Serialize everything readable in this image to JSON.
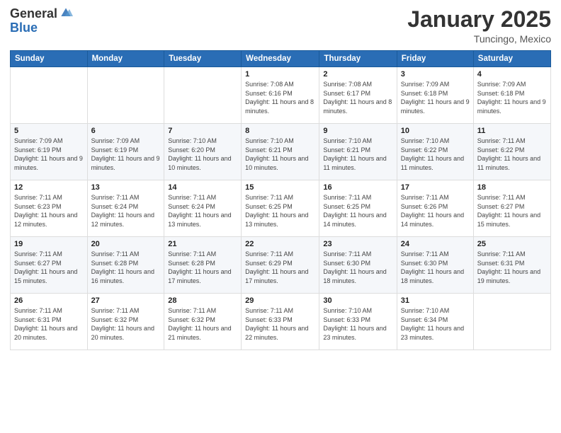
{
  "logo": {
    "general": "General",
    "blue": "Blue"
  },
  "header": {
    "month": "January 2025",
    "location": "Tuncingo, Mexico"
  },
  "days_of_week": [
    "Sunday",
    "Monday",
    "Tuesday",
    "Wednesday",
    "Thursday",
    "Friday",
    "Saturday"
  ],
  "weeks": [
    [
      {
        "num": "",
        "detail": ""
      },
      {
        "num": "",
        "detail": ""
      },
      {
        "num": "",
        "detail": ""
      },
      {
        "num": "1",
        "detail": "Sunrise: 7:08 AM\nSunset: 6:16 PM\nDaylight: 11 hours and 8 minutes."
      },
      {
        "num": "2",
        "detail": "Sunrise: 7:08 AM\nSunset: 6:17 PM\nDaylight: 11 hours and 8 minutes."
      },
      {
        "num": "3",
        "detail": "Sunrise: 7:09 AM\nSunset: 6:18 PM\nDaylight: 11 hours and 9 minutes."
      },
      {
        "num": "4",
        "detail": "Sunrise: 7:09 AM\nSunset: 6:18 PM\nDaylight: 11 hours and 9 minutes."
      }
    ],
    [
      {
        "num": "5",
        "detail": "Sunrise: 7:09 AM\nSunset: 6:19 PM\nDaylight: 11 hours and 9 minutes."
      },
      {
        "num": "6",
        "detail": "Sunrise: 7:09 AM\nSunset: 6:19 PM\nDaylight: 11 hours and 9 minutes."
      },
      {
        "num": "7",
        "detail": "Sunrise: 7:10 AM\nSunset: 6:20 PM\nDaylight: 11 hours and 10 minutes."
      },
      {
        "num": "8",
        "detail": "Sunrise: 7:10 AM\nSunset: 6:21 PM\nDaylight: 11 hours and 10 minutes."
      },
      {
        "num": "9",
        "detail": "Sunrise: 7:10 AM\nSunset: 6:21 PM\nDaylight: 11 hours and 11 minutes."
      },
      {
        "num": "10",
        "detail": "Sunrise: 7:10 AM\nSunset: 6:22 PM\nDaylight: 11 hours and 11 minutes."
      },
      {
        "num": "11",
        "detail": "Sunrise: 7:11 AM\nSunset: 6:22 PM\nDaylight: 11 hours and 11 minutes."
      }
    ],
    [
      {
        "num": "12",
        "detail": "Sunrise: 7:11 AM\nSunset: 6:23 PM\nDaylight: 11 hours and 12 minutes."
      },
      {
        "num": "13",
        "detail": "Sunrise: 7:11 AM\nSunset: 6:24 PM\nDaylight: 11 hours and 12 minutes."
      },
      {
        "num": "14",
        "detail": "Sunrise: 7:11 AM\nSunset: 6:24 PM\nDaylight: 11 hours and 13 minutes."
      },
      {
        "num": "15",
        "detail": "Sunrise: 7:11 AM\nSunset: 6:25 PM\nDaylight: 11 hours and 13 minutes."
      },
      {
        "num": "16",
        "detail": "Sunrise: 7:11 AM\nSunset: 6:25 PM\nDaylight: 11 hours and 14 minutes."
      },
      {
        "num": "17",
        "detail": "Sunrise: 7:11 AM\nSunset: 6:26 PM\nDaylight: 11 hours and 14 minutes."
      },
      {
        "num": "18",
        "detail": "Sunrise: 7:11 AM\nSunset: 6:27 PM\nDaylight: 11 hours and 15 minutes."
      }
    ],
    [
      {
        "num": "19",
        "detail": "Sunrise: 7:11 AM\nSunset: 6:27 PM\nDaylight: 11 hours and 15 minutes."
      },
      {
        "num": "20",
        "detail": "Sunrise: 7:11 AM\nSunset: 6:28 PM\nDaylight: 11 hours and 16 minutes."
      },
      {
        "num": "21",
        "detail": "Sunrise: 7:11 AM\nSunset: 6:28 PM\nDaylight: 11 hours and 17 minutes."
      },
      {
        "num": "22",
        "detail": "Sunrise: 7:11 AM\nSunset: 6:29 PM\nDaylight: 11 hours and 17 minutes."
      },
      {
        "num": "23",
        "detail": "Sunrise: 7:11 AM\nSunset: 6:30 PM\nDaylight: 11 hours and 18 minutes."
      },
      {
        "num": "24",
        "detail": "Sunrise: 7:11 AM\nSunset: 6:30 PM\nDaylight: 11 hours and 18 minutes."
      },
      {
        "num": "25",
        "detail": "Sunrise: 7:11 AM\nSunset: 6:31 PM\nDaylight: 11 hours and 19 minutes."
      }
    ],
    [
      {
        "num": "26",
        "detail": "Sunrise: 7:11 AM\nSunset: 6:31 PM\nDaylight: 11 hours and 20 minutes."
      },
      {
        "num": "27",
        "detail": "Sunrise: 7:11 AM\nSunset: 6:32 PM\nDaylight: 11 hours and 20 minutes."
      },
      {
        "num": "28",
        "detail": "Sunrise: 7:11 AM\nSunset: 6:32 PM\nDaylight: 11 hours and 21 minutes."
      },
      {
        "num": "29",
        "detail": "Sunrise: 7:11 AM\nSunset: 6:33 PM\nDaylight: 11 hours and 22 minutes."
      },
      {
        "num": "30",
        "detail": "Sunrise: 7:10 AM\nSunset: 6:33 PM\nDaylight: 11 hours and 23 minutes."
      },
      {
        "num": "31",
        "detail": "Sunrise: 7:10 AM\nSunset: 6:34 PM\nDaylight: 11 hours and 23 minutes."
      },
      {
        "num": "",
        "detail": ""
      }
    ]
  ]
}
